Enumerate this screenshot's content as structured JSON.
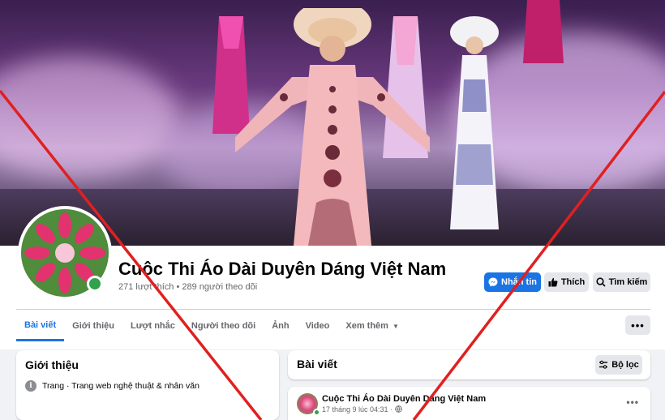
{
  "page": {
    "title": "Cuộc Thi Áo Dài Duyên Dáng Việt Nam",
    "stats": "271 lượt thích • 289 người theo dõi"
  },
  "actions": {
    "message_label": "Nhắn tin",
    "like_label": "Thích",
    "search_label": "Tìm kiếm",
    "more_label": "•••"
  },
  "tabs": [
    {
      "label": "Bài viết",
      "active": true
    },
    {
      "label": "Giới thiệu"
    },
    {
      "label": "Lượt nhắc"
    },
    {
      "label": "Người theo dõi"
    },
    {
      "label": "Ảnh"
    },
    {
      "label": "Video"
    },
    {
      "label": "Xem thêm",
      "caret": "▼"
    }
  ],
  "intro": {
    "title": "Giới thiệu",
    "info": "Trang · Trang web nghệ thuật & nhân văn",
    "info_icon": "i"
  },
  "posts": {
    "title": "Bài viết",
    "filter_label": "Bộ lọc"
  },
  "post": {
    "author": "Cuộc Thi Áo Dài Duyên Dáng Việt Nam",
    "time": "17 tháng 9 lúc 04:31 ·",
    "more": "•••"
  },
  "colors": {
    "accent": "#1b74e4",
    "cross": "#e02020",
    "online": "#31a24c"
  }
}
